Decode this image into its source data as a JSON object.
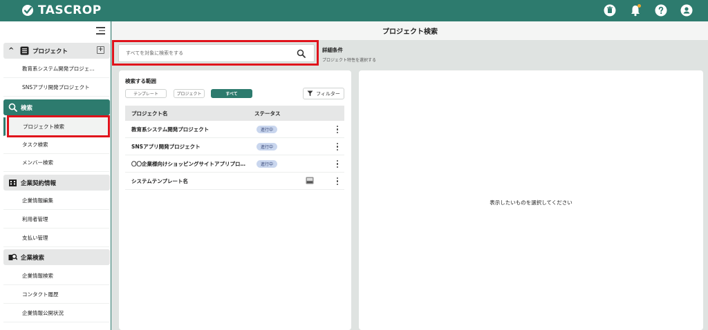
{
  "app": {
    "name": "TASCROP"
  },
  "topbar": {
    "icons": [
      "trash-icon",
      "bell-icon",
      "help-icon",
      "user-icon"
    ],
    "accent": "#2d7b6e",
    "notification_dot": "#f0a830"
  },
  "sidebar": {
    "project_group": {
      "label": "プロジェクト",
      "items": [
        "教育系システム開発プロジェ…",
        "SNSアプリ開発プロジェクト"
      ]
    },
    "search_group": {
      "label": "検索",
      "items": [
        "プロジェクト検索",
        "タスク検索",
        "メンバー検索"
      ],
      "selected": "プロジェクト検索"
    },
    "contract_group": {
      "label": "企業契約情報",
      "items": [
        "企業情報編集",
        "利用者管理",
        "支払い管理"
      ]
    },
    "company_search_group": {
      "label": "企業検索",
      "items": [
        "企業情報検索",
        "コンタクト履歴",
        "企業情報公開状況"
      ]
    }
  },
  "main": {
    "title": "プロジェクト検索",
    "search": {
      "placeholder": "すべてを対象に検索をする",
      "value": ""
    },
    "detail": {
      "title": "詳細条件",
      "subtitle": "プロジェクト特性を選択する"
    },
    "range": {
      "label": "検索する範囲",
      "chips": [
        "テンプレート",
        "プロジェクト",
        "すべて"
      ],
      "active": "すべて"
    },
    "filter_label": "フィルター",
    "table": {
      "headers": [
        "プロジェクト名",
        "ステータス"
      ],
      "rows": [
        {
          "name": "教育系システム開発プロジェクト",
          "status": "進行中"
        },
        {
          "name": "SNSアプリ開発プロジェクト",
          "status": "進行中"
        },
        {
          "name": "〇〇企業様向けショッピングサイトアプリプロ…",
          "status": "進行中"
        },
        {
          "name": "システムテンプレート名",
          "status": "",
          "icon": "template-icon"
        }
      ]
    },
    "detail_panel": {
      "empty_message": "表示したいものを選択してください"
    }
  }
}
